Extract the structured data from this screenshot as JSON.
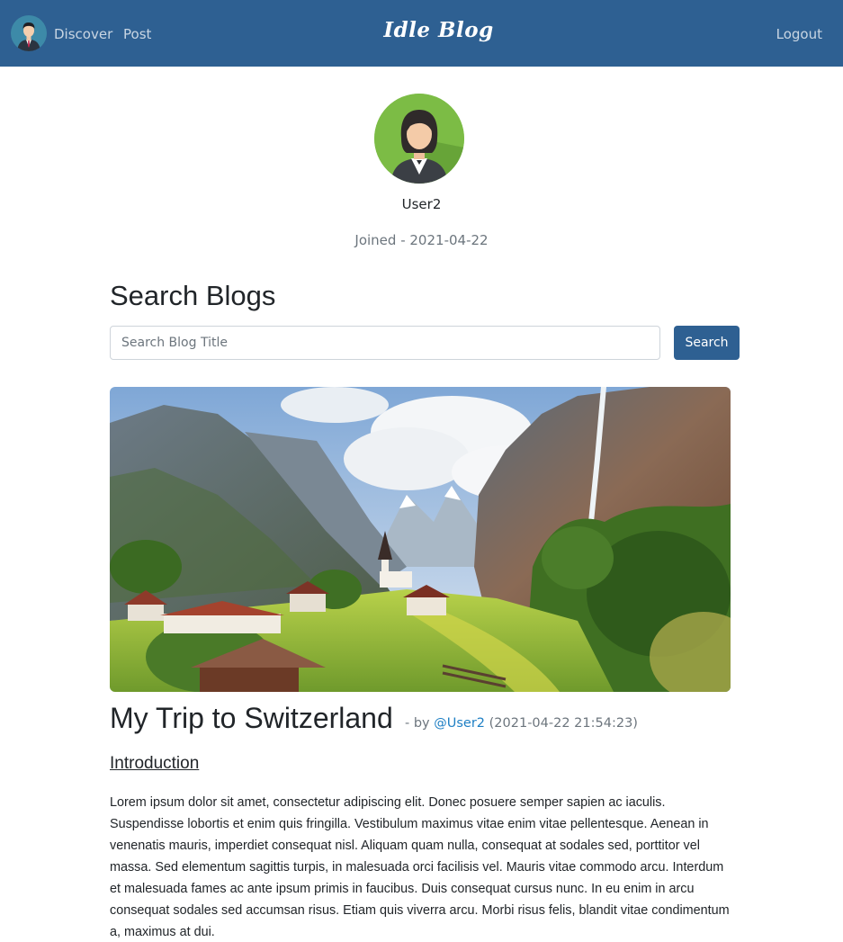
{
  "nav": {
    "discover_label": "Discover",
    "post_label": "Post",
    "brand": "Idle Blog",
    "logout_label": "Logout"
  },
  "profile": {
    "username": "User2",
    "joined_prefix": "Joined - ",
    "joined_date": "2021-04-22"
  },
  "search": {
    "title": "Search Blogs",
    "placeholder": "Search Blog Title",
    "button_label": "Search"
  },
  "post": {
    "title": "My Trip to Switzerland",
    "by_prefix": "- by ",
    "author": "@User2",
    "timestamp": "(2021-04-22 21:54:23)",
    "section_heading": "Introduction",
    "body": "Lorem ipsum dolor sit amet, consectetur adipiscing elit. Donec posuere semper sapien ac iaculis. Suspendisse lobortis et enim quis fringilla. Vestibulum maximus vitae enim vitae pellentesque. Aenean in venenatis mauris, imperdiet consequat nisl. Aliquam quam nulla, consequat at sodales sed, porttitor vel massa. Sed elementum sagittis turpis, in malesuada orci facilisis vel. Mauris vitae commodo arcu. Interdum et malesuada fames ac ante ipsum primis in faucibus. Duis consequat cursus nunc. In eu enim in arcu consequat sodales sed accumsan risus. Etiam quis viverra arcu. Morbi risus felis, blandit vitae condimentum a, maximus at dui."
  },
  "colors": {
    "navbar": "#2e6092",
    "accent_button": "#2e6092",
    "link": "#1e7fc4",
    "muted_text": "#6c757d"
  }
}
